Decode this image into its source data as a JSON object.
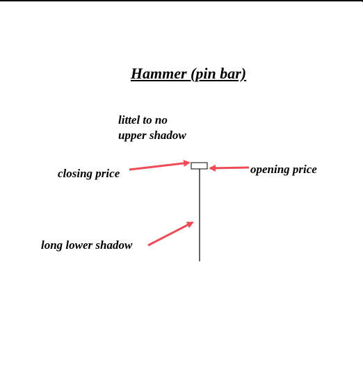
{
  "title": "Hammer (pin bar)",
  "labels": {
    "upper_shadow_line1": "littel to no",
    "upper_shadow_line2": "upper shadow",
    "closing_price": "closing price",
    "opening_price": "opening price",
    "lower_shadow": "long lower shadow"
  },
  "colors": {
    "arrow": "#ef4b55",
    "candle": "#000000"
  }
}
